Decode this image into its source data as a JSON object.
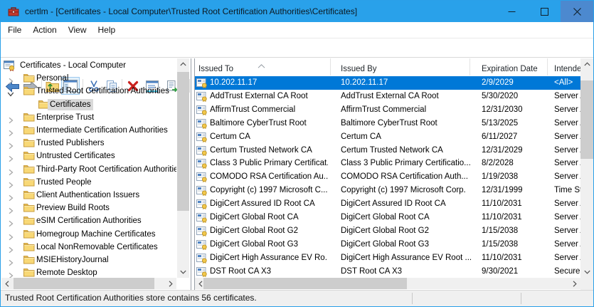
{
  "window": {
    "title": "certlm - [Certificates - Local Computer\\Trusted Root Certification Authorities\\Certificates]",
    "app_icon": "mmc-toolbox",
    "controls": [
      "minimize",
      "maximize",
      "close"
    ]
  },
  "colors": {
    "titlebar": "#29A1EA",
    "close_button": "#4C89CF",
    "list_selection": "#0078D7",
    "tree_selection": "#D9D9D9",
    "window_border": "#2AA0E9"
  },
  "menu": {
    "items": [
      "File",
      "Action",
      "View",
      "Help"
    ]
  },
  "toolbar": {
    "icons": [
      "back",
      "forward",
      "up-one-level",
      "show-hide-console-tree",
      "cut",
      "copy",
      "delete",
      "properties",
      "export-list",
      "help",
      "show-hide-action-pane"
    ],
    "active_icon": "show-hide-console-tree"
  },
  "tree": {
    "items": [
      {
        "label": "Certificates - Local Computer",
        "level": 0,
        "icon": "console",
        "chevron": null,
        "selected": false
      },
      {
        "label": "Personal",
        "level": 1,
        "icon": "folder",
        "chevron": "collapsed",
        "selected": false
      },
      {
        "label": "Trusted Root Certification Authorities",
        "level": 1,
        "icon": "folder",
        "chevron": "expanded",
        "selected": false
      },
      {
        "label": "Certificates",
        "level": 2,
        "icon": "folder",
        "chevron": null,
        "selected": true
      },
      {
        "label": "Enterprise Trust",
        "level": 1,
        "icon": "folder",
        "chevron": "collapsed",
        "selected": false
      },
      {
        "label": "Intermediate Certification Authorities",
        "level": 1,
        "icon": "folder",
        "chevron": "collapsed",
        "selected": false
      },
      {
        "label": "Trusted Publishers",
        "level": 1,
        "icon": "folder",
        "chevron": "collapsed",
        "selected": false
      },
      {
        "label": "Untrusted Certificates",
        "level": 1,
        "icon": "folder",
        "chevron": "collapsed",
        "selected": false
      },
      {
        "label": "Third-Party Root Certification Authorities",
        "level": 1,
        "icon": "folder",
        "chevron": "collapsed",
        "selected": false
      },
      {
        "label": "Trusted People",
        "level": 1,
        "icon": "folder",
        "chevron": "collapsed",
        "selected": false
      },
      {
        "label": "Client Authentication Issuers",
        "level": 1,
        "icon": "folder",
        "chevron": "collapsed",
        "selected": false
      },
      {
        "label": "Preview Build Roots",
        "level": 1,
        "icon": "folder",
        "chevron": "collapsed",
        "selected": false
      },
      {
        "label": "eSIM Certification Authorities",
        "level": 1,
        "icon": "folder",
        "chevron": "collapsed",
        "selected": false
      },
      {
        "label": "Homegroup Machine Certificates",
        "level": 1,
        "icon": "folder",
        "chevron": "collapsed",
        "selected": false
      },
      {
        "label": "Local NonRemovable Certificates",
        "level": 1,
        "icon": "folder",
        "chevron": "collapsed",
        "selected": false
      },
      {
        "label": "MSIEHistoryJournal",
        "level": 1,
        "icon": "folder",
        "chevron": "collapsed",
        "selected": false
      },
      {
        "label": "Remote Desktop",
        "level": 1,
        "icon": "folder",
        "chevron": "collapsed",
        "selected": false
      }
    ]
  },
  "list": {
    "columns": [
      {
        "label": "Issued To",
        "sort": "asc"
      },
      {
        "label": "Issued By",
        "sort": null
      },
      {
        "label": "Expiration Date",
        "sort": null
      },
      {
        "label": "Intended Purposes",
        "sort": null
      }
    ],
    "rows": [
      {
        "issued_to": "10.202.11.17",
        "issued_by": "10.202.11.17",
        "expiration": "2/9/2029",
        "purposes": "<All>",
        "selected": true
      },
      {
        "issued_to": "AddTrust External CA Root",
        "issued_by": "AddTrust External CA Root",
        "expiration": "5/30/2020",
        "purposes": "Server Au",
        "selected": false
      },
      {
        "issued_to": "AffirmTrust Commercial",
        "issued_by": "AffirmTrust Commercial",
        "expiration": "12/31/2030",
        "purposes": "Server Au",
        "selected": false
      },
      {
        "issued_to": "Baltimore CyberTrust Root",
        "issued_by": "Baltimore CyberTrust Root",
        "expiration": "5/13/2025",
        "purposes": "Server Au",
        "selected": false
      },
      {
        "issued_to": "Certum CA",
        "issued_by": "Certum CA",
        "expiration": "6/11/2027",
        "purposes": "Server Au",
        "selected": false
      },
      {
        "issued_to": "Certum Trusted Network CA",
        "issued_by": "Certum Trusted Network CA",
        "expiration": "12/31/2029",
        "purposes": "Server Au",
        "selected": false
      },
      {
        "issued_to": "Class 3 Public Primary Certificat...",
        "issued_by": "Class 3 Public Primary Certificatio...",
        "expiration": "8/2/2028",
        "purposes": "Server Au",
        "selected": false
      },
      {
        "issued_to": "COMODO RSA Certification Au...",
        "issued_by": "COMODO RSA Certification Auth...",
        "expiration": "1/19/2038",
        "purposes": "Server Au",
        "selected": false
      },
      {
        "issued_to": "Copyright (c) 1997 Microsoft C...",
        "issued_by": "Copyright (c) 1997 Microsoft Corp.",
        "expiration": "12/31/1999",
        "purposes": "Time Sta",
        "selected": false
      },
      {
        "issued_to": "DigiCert Assured ID Root CA",
        "issued_by": "DigiCert Assured ID Root CA",
        "expiration": "11/10/2031",
        "purposes": "Server Au",
        "selected": false
      },
      {
        "issued_to": "DigiCert Global Root CA",
        "issued_by": "DigiCert Global Root CA",
        "expiration": "11/10/2031",
        "purposes": "Server Au",
        "selected": false
      },
      {
        "issued_to": "DigiCert Global Root G2",
        "issued_by": "DigiCert Global Root G2",
        "expiration": "1/15/2038",
        "purposes": "Server Au",
        "selected": false
      },
      {
        "issued_to": "DigiCert Global Root G3",
        "issued_by": "DigiCert Global Root G3",
        "expiration": "1/15/2038",
        "purposes": "Server Au",
        "selected": false
      },
      {
        "issued_to": "DigiCert High Assurance EV Ro...",
        "issued_by": "DigiCert High Assurance EV Root ...",
        "expiration": "11/10/2031",
        "purposes": "Server Au",
        "selected": false
      },
      {
        "issued_to": "DST Root CA X3",
        "issued_by": "DST Root CA X3",
        "expiration": "9/30/2021",
        "purposes": "Secure",
        "selected": false
      }
    ]
  },
  "statusbar": {
    "text": "Trusted Root Certification Authorities store contains 56 certificates."
  }
}
